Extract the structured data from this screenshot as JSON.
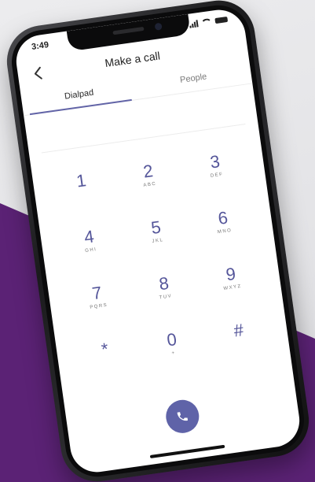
{
  "status_bar": {
    "time": "3:49"
  },
  "header": {
    "title": "Make a call",
    "back_icon": "chevron-left-icon"
  },
  "tabs": [
    {
      "label": "Dialpad",
      "active": true
    },
    {
      "label": "People",
      "active": false
    }
  ],
  "dialpad": {
    "keys": [
      {
        "digit": "1",
        "letters": ""
      },
      {
        "digit": "2",
        "letters": "ABC"
      },
      {
        "digit": "3",
        "letters": "DEF"
      },
      {
        "digit": "4",
        "letters": "GHI"
      },
      {
        "digit": "5",
        "letters": "JKL"
      },
      {
        "digit": "6",
        "letters": "MNO"
      },
      {
        "digit": "7",
        "letters": "PQRS"
      },
      {
        "digit": "8",
        "letters": "TUV"
      },
      {
        "digit": "9",
        "letters": "WXYZ"
      },
      {
        "digit": "*",
        "letters": ""
      },
      {
        "digit": "0",
        "letters": "+"
      },
      {
        "digit": "#",
        "letters": ""
      }
    ]
  },
  "call_button": {
    "icon": "phone-icon"
  },
  "colors": {
    "accent": "#6264a7",
    "background_purple": "#5b2275",
    "background_light": "#e9e9eb"
  }
}
